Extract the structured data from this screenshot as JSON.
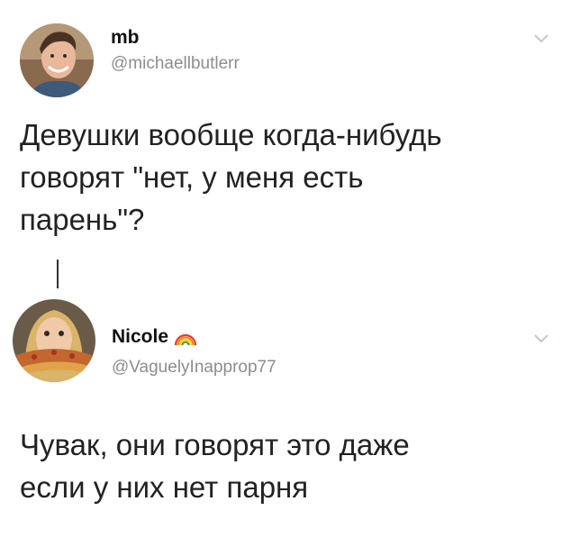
{
  "tweets": [
    {
      "display_name": "mb",
      "handle": "@michaellbutlerr",
      "text": "Девушки вообще когда-нибудь\nговорят \"нет, у меня есть\nпарень\"?",
      "avatar_icon": "person-avatar-icon",
      "menu_icon": "chevron-down-icon"
    },
    {
      "display_name": "Nicole",
      "name_emoji": "rainbow-icon",
      "handle": "@VaguelyInapprop77",
      "text": "Чувак, они говорят это даже\nесли у них нет парня",
      "avatar_icon": "person-with-pizza-avatar-icon",
      "menu_icon": "chevron-down-icon"
    }
  ],
  "colors": {
    "text": "#222222",
    "handle": "#8a8d91",
    "chevron": "#c4c8cc",
    "thread_line": "#333333"
  }
}
